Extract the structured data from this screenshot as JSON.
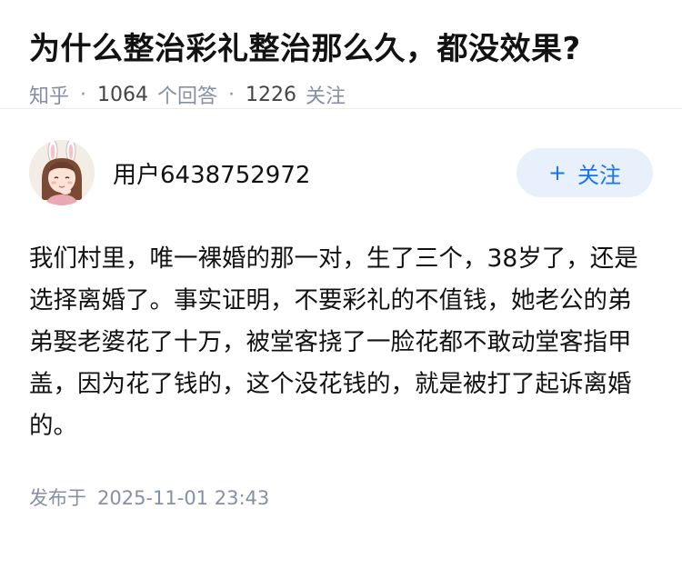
{
  "question": {
    "title": "为什么整治彩礼整治那么久，都没效果?",
    "source": "知乎",
    "separator": "·",
    "answers_count": "1064",
    "answers_label": "个回答",
    "followers_count": "1226",
    "followers_label": "关注"
  },
  "answer": {
    "author": {
      "name": "用户6438752972",
      "avatar_icon": "avatar-girl-bunny-ears"
    },
    "follow_button": {
      "plus": "+",
      "label": "关注"
    },
    "content": "我们村里，唯一裸婚的那一对，生了三个，38岁了，还是选择离婚了。事实证明，不要彩礼的不值钱，她老公的弟弟娶老婆花了十万，被堂客挠了一脸花都不敢动堂客指甲盖，因为花了钱的，这个没花钱的，就是被打了起诉离婚的。",
    "footer": {
      "published_label": "发布于",
      "published_time": "2025-11-01 23:43"
    }
  },
  "colors": {
    "accent": "#1772f6",
    "follow_bg": "#e8f1fb",
    "meta_gray": "#8590a6",
    "text": "#121212"
  }
}
